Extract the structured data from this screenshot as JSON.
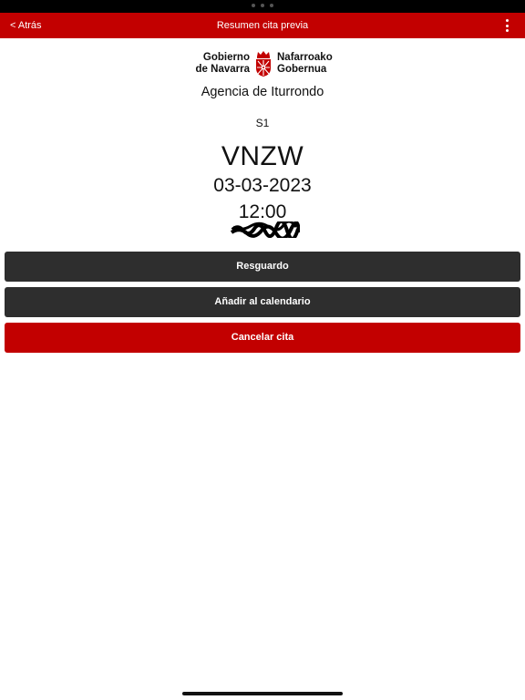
{
  "colors": {
    "primary_red": "#c20000",
    "dark_button": "#2e2e2e",
    "text": "#111111"
  },
  "nav": {
    "back_label": "< Atrás",
    "title": "Resumen cita previa",
    "menu_icon": "kebab-menu-icon"
  },
  "logo": {
    "left_line1": "Gobierno",
    "left_line2": "de Navarra",
    "right_line1": "Nafarroako",
    "right_line2": "Gobernua",
    "icon": "navarra-coat-of-arms-icon"
  },
  "appointment": {
    "agency": "Agencia de Iturrondo",
    "office": "S1",
    "code": "VNZW",
    "date": "03-03-2023",
    "time": "12:00"
  },
  "actions": {
    "receipt_label": "Resguardo",
    "calendar_label": "Añadir al calendario",
    "cancel_label": "Cancelar cita"
  }
}
